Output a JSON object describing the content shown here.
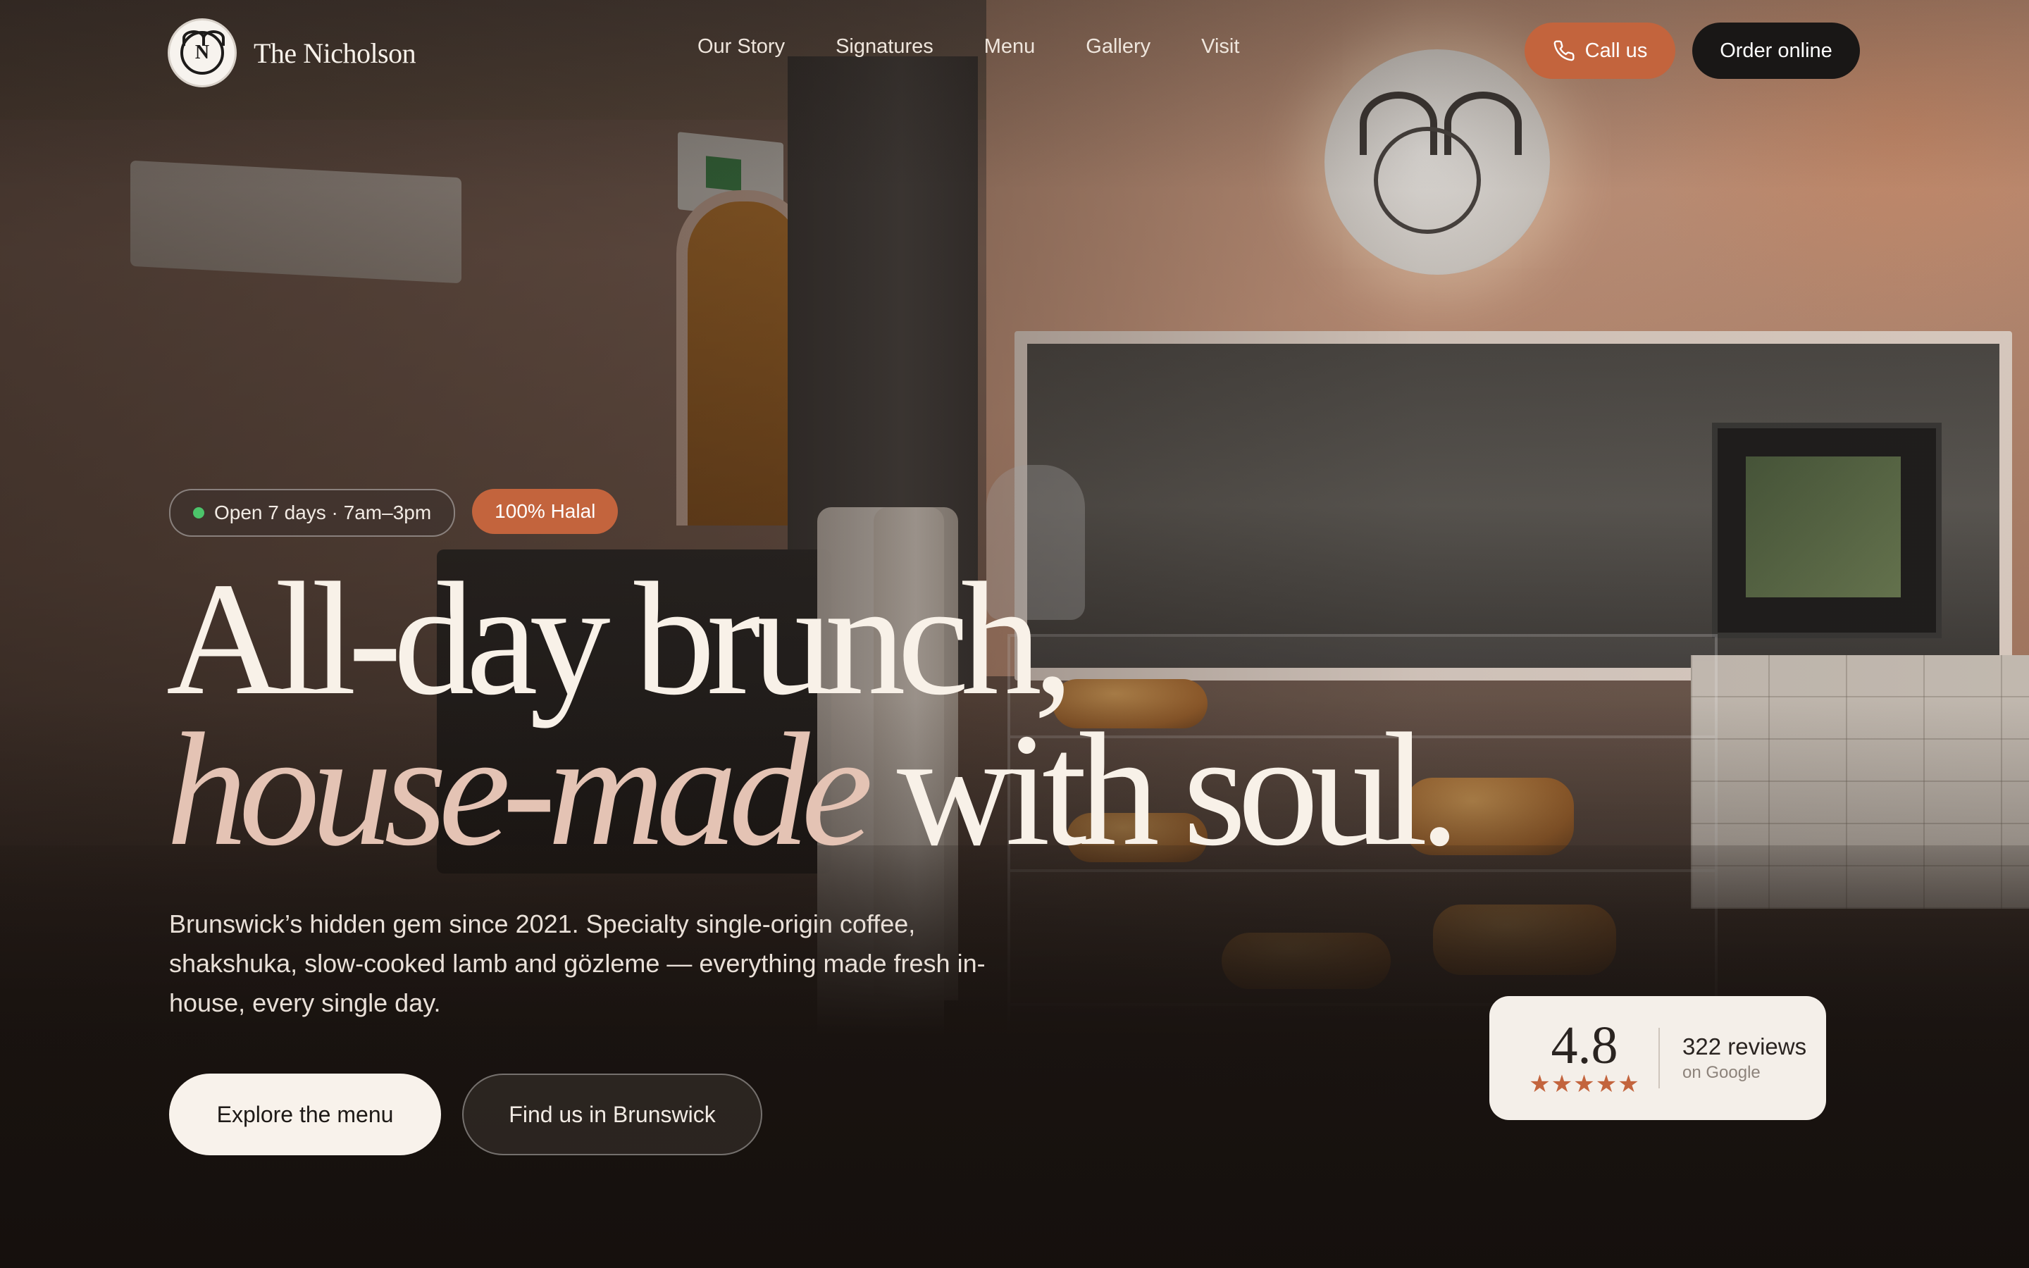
{
  "brand": {
    "name": "The Nicholson",
    "logo_letter": "N"
  },
  "nav": {
    "links": [
      "Our Story",
      "Signatures",
      "Menu",
      "Gallery",
      "Visit"
    ],
    "call_label": "Call us",
    "order_label": "Order online"
  },
  "hero": {
    "badge_open": "Open 7 days · 7am–3pm",
    "badge_halal": "100% Halal",
    "headline_line1": "All-day brunch,",
    "headline_em": "house-made",
    "headline_rest": " with soul.",
    "subtext": "Brunswick’s hidden gem since 2021. Specialty single-origin coffee, shakshuka, slow-cooked lamb and gözleme — everything made fresh in-house, every single day.",
    "cta_primary": "Explore the menu",
    "cta_secondary": "Find us in Brunswick"
  },
  "rating": {
    "score": "4.8",
    "stars": "★★★★★",
    "reviews": "322 reviews",
    "source": "on Google"
  },
  "colors": {
    "accent": "#c3643d",
    "dark": "#191716",
    "cream": "#f8f2eb",
    "headline_em": "#e4c3b4",
    "open_dot": "#4cc46a"
  },
  "icons": [
    "phone-icon",
    "status-dot-icon",
    "star-icon",
    "stag-logo-icon"
  ]
}
